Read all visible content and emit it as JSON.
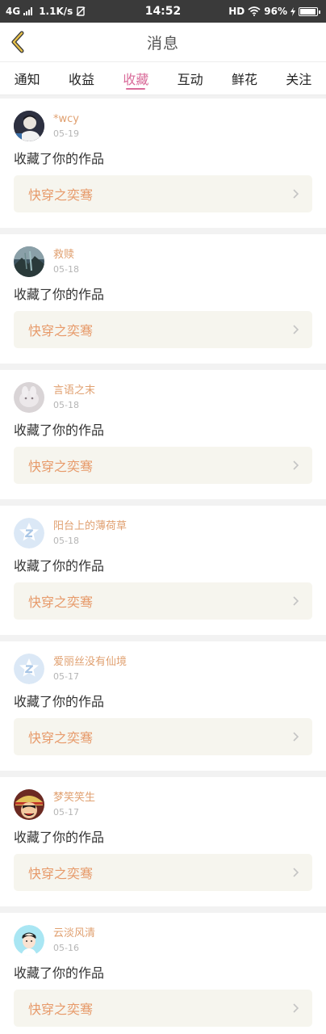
{
  "status_bar": {
    "network": "4G",
    "speed": "1.1K/s",
    "time": "14:52",
    "hd": "HD",
    "battery": "96%",
    "battery_level": 0.96
  },
  "header": {
    "title": "消息",
    "back_icon": "chevron-left-icon"
  },
  "tabs": [
    {
      "label": "通知",
      "active": false
    },
    {
      "label": "收益",
      "active": false
    },
    {
      "label": "收藏",
      "active": true
    },
    {
      "label": "互动",
      "active": false
    },
    {
      "label": "鲜花",
      "active": false
    },
    {
      "label": "关注",
      "active": false
    }
  ],
  "colors": {
    "accent": "#d96b9a",
    "username": "#e0a070",
    "work_title": "#e79a6a",
    "work_bg": "#f6f5ee"
  },
  "items": [
    {
      "user": "*wcy",
      "date": "05-19",
      "action": "收藏了你的作品",
      "work": "快穿之奕骞",
      "avatar": "photo-boy"
    },
    {
      "user": "救赎",
      "date": "05-18",
      "action": "收藏了你的作品",
      "work": "快穿之奕骞",
      "avatar": "photo-landscape"
    },
    {
      "user": "言语之末",
      "date": "05-18",
      "action": "收藏了你的作品",
      "work": "快穿之奕骞",
      "avatar": "photo-animal"
    },
    {
      "user": "阳台上的薄荷草",
      "date": "05-18",
      "action": "收藏了你的作品",
      "work": "快穿之奕骞",
      "avatar": "default-z"
    },
    {
      "user": "爱丽丝没有仙境",
      "date": "05-17",
      "action": "收藏了你的作品",
      "work": "快穿之奕骞",
      "avatar": "default-z"
    },
    {
      "user": "梦笑笑生",
      "date": "05-17",
      "action": "收藏了你的作品",
      "work": "快穿之奕骞",
      "avatar": "anime-pirate"
    },
    {
      "user": "云淡风清",
      "date": "05-16",
      "action": "收藏了你的作品",
      "work": "快穿之奕骞",
      "avatar": "cartoon-girl"
    }
  ]
}
